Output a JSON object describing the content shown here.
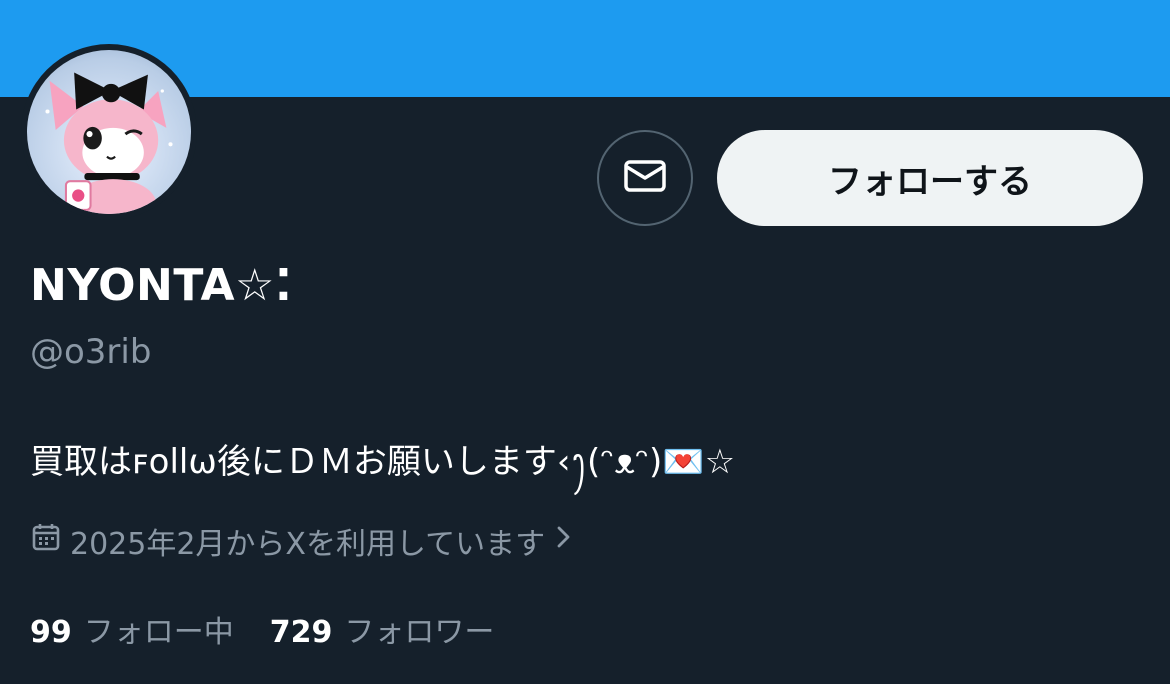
{
  "profile": {
    "display_name": "NYONTA☆⁚",
    "handle": "@o3rib",
    "bio": "買取はꜰollѡ後にＤＭお願いします‹ꫂ(ᵔᴥᵔ)💌☆",
    "joined": "2025年2月からXを利用しています"
  },
  "actions": {
    "follow_label": "フォローする"
  },
  "stats": {
    "following_count": "99",
    "following_label": "フォロー中",
    "followers_count": "729",
    "followers_label": "フォロワー"
  },
  "colors": {
    "banner": "#1d9bf0",
    "background": "#15202b",
    "secondary_text": "#8b98a5",
    "follow_button_bg": "#eff3f4"
  },
  "icons": {
    "dm": "mail-icon",
    "joined": "calendar-icon",
    "joined_more": "chevron-right-icon"
  }
}
